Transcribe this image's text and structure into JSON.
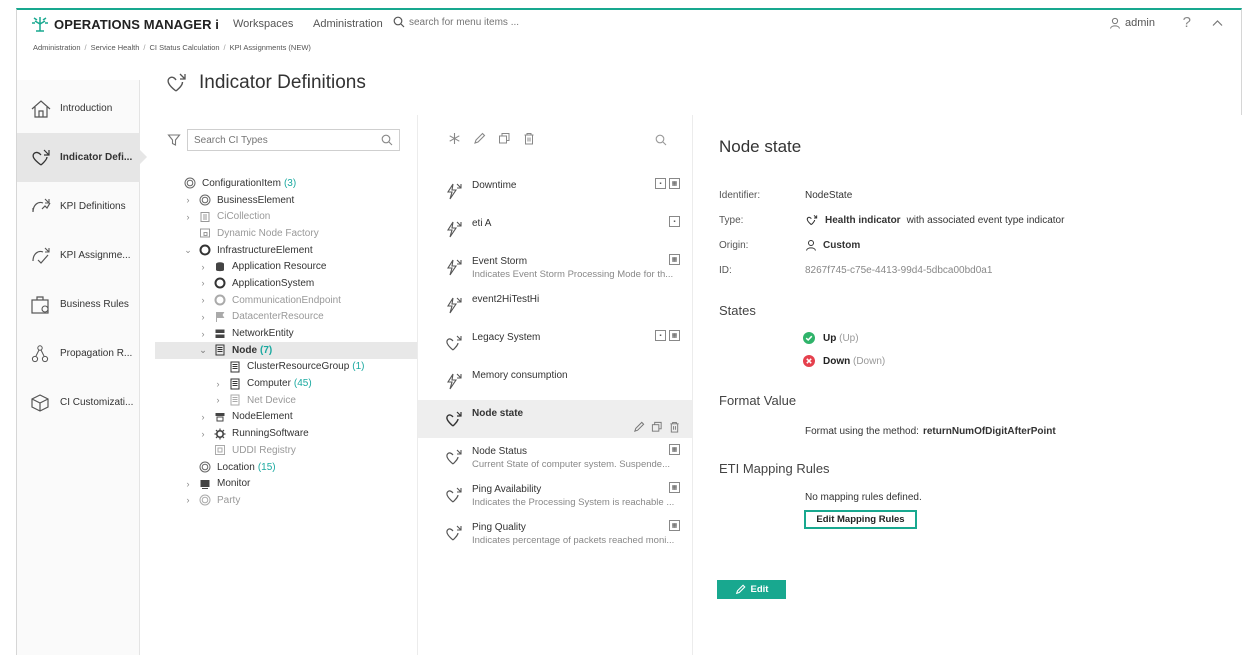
{
  "header": {
    "brand": "OPERATIONS MANAGER i",
    "nav": [
      "Workspaces",
      "Administration"
    ],
    "search_placeholder": "search for menu items ...",
    "user": "admin",
    "help": "?"
  },
  "breadcrumb": [
    "Administration",
    "Service Health",
    "CI Status Calculation",
    "KPI Assignments (NEW)"
  ],
  "sidebar": {
    "items": [
      {
        "label": "Introduction",
        "icon": "home-icon"
      },
      {
        "label": "Indicator Defi...",
        "icon": "indicator-icon"
      },
      {
        "label": "KPI Definitions",
        "icon": "kpi-icon"
      },
      {
        "label": "KPI Assignme...",
        "icon": "kpi-assign-icon"
      },
      {
        "label": "Business Rules",
        "icon": "business-rules-icon"
      },
      {
        "label": "Propagation R...",
        "icon": "propagation-icon"
      },
      {
        "label": "CI Customizati...",
        "icon": "cube-icon"
      }
    ]
  },
  "page_title": "Indicator Definitions",
  "ci_panel": {
    "search_placeholder": "Search CI Types",
    "tree": [
      {
        "label": "ConfigurationItem",
        "count": "(3)"
      },
      {
        "label": "BusinessElement",
        "count": ""
      },
      {
        "label": "CiCollection",
        "count": ""
      },
      {
        "label": "Dynamic Node Factory",
        "count": ""
      },
      {
        "label": "InfrastructureElement",
        "count": ""
      },
      {
        "label": "Application Resource",
        "count": ""
      },
      {
        "label": "ApplicationSystem",
        "count": ""
      },
      {
        "label": "CommunicationEndpoint",
        "count": ""
      },
      {
        "label": "DatacenterResource",
        "count": ""
      },
      {
        "label": "NetworkEntity",
        "count": ""
      },
      {
        "label": "Node",
        "count": "(7)"
      },
      {
        "label": "ClusterResourceGroup",
        "count": "(1)"
      },
      {
        "label": "Computer",
        "count": "(45)"
      },
      {
        "label": "Net Device",
        "count": ""
      },
      {
        "label": "NodeElement",
        "count": ""
      },
      {
        "label": "RunningSoftware",
        "count": ""
      },
      {
        "label": "UDDI Registry",
        "count": ""
      },
      {
        "label": "Location",
        "count": "(15)"
      },
      {
        "label": "Monitor",
        "count": ""
      },
      {
        "label": "Party",
        "count": ""
      }
    ]
  },
  "list_panel": {
    "items": [
      {
        "name": "Downtime",
        "desc": ""
      },
      {
        "name": "eti A",
        "desc": ""
      },
      {
        "name": "Event Storm",
        "desc": "Indicates Event Storm Processing Mode for th..."
      },
      {
        "name": "event2HiTestHi",
        "desc": ""
      },
      {
        "name": "Legacy System",
        "desc": ""
      },
      {
        "name": "Memory consumption",
        "desc": ""
      },
      {
        "name": "Node state",
        "desc": ""
      },
      {
        "name": "Node Status",
        "desc": "Current State of computer system. Suspende..."
      },
      {
        "name": "Ping Availability",
        "desc": "Indicates the Processing System is reachable ..."
      },
      {
        "name": "Ping Quality",
        "desc": "Indicates percentage of packets reached moni..."
      }
    ]
  },
  "details": {
    "title": "Node state",
    "identifier_label": "Identifier:",
    "identifier": "NodeState",
    "type_label": "Type:",
    "type_bold": "Health indicator",
    "type_rest": "with associated event type indicator",
    "origin_label": "Origin:",
    "origin": "Custom",
    "id_label": "ID:",
    "id": "8267f745-c75e-4413-99d4-5dbca00bd0a1",
    "states_title": "States",
    "states": [
      {
        "name": "Up",
        "alt": "(Up)",
        "color": "#2fb36a"
      },
      {
        "name": "Down",
        "alt": "(Down)",
        "color": "#e5404d"
      }
    ],
    "format_title": "Format Value",
    "format_text": "Format using the method:",
    "format_method": "returnNumOfDigitAfterPoint",
    "eti_title": "ETI Mapping Rules",
    "no_mapping": "No mapping rules defined.",
    "edit_mapping": "Edit Mapping Rules",
    "edit": "Edit"
  },
  "colors": {
    "accent": "#18a88f",
    "count": "#1aa9a0"
  }
}
